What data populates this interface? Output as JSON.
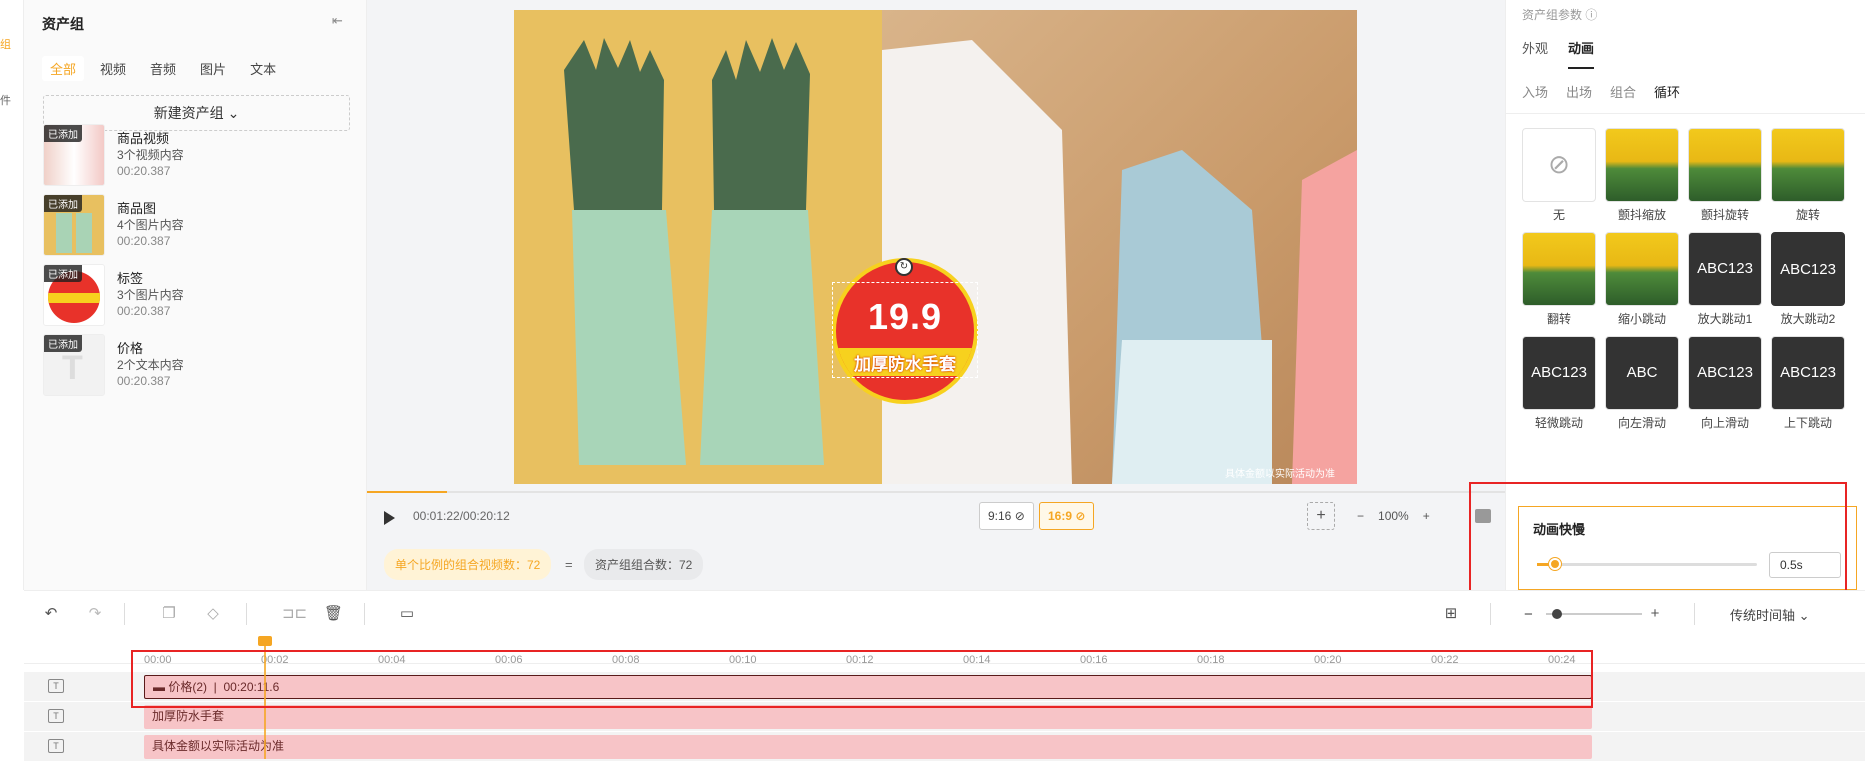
{
  "left_strip": {
    "mark1": "组",
    "mark2": "件"
  },
  "assets": {
    "title": "资产组",
    "collapse_icon": "collapse-icon",
    "tabs": [
      "全部",
      "视频",
      "音频",
      "图片",
      "文本"
    ],
    "new_group": "新建资产组",
    "items": [
      {
        "badge": "已添加",
        "name": "商品视频",
        "count": "3个视频内容",
        "duration": "00:20.387"
      },
      {
        "badge": "已添加",
        "name": "商品图",
        "count": "4个图片内容",
        "duration": "00:20.387"
      },
      {
        "badge": "已添加",
        "name": "标签",
        "count": "3个图片内容",
        "duration": "00:20.387"
      },
      {
        "badge": "已添加",
        "name": "价格",
        "count": "2个文本内容",
        "duration": "00:20.387"
      }
    ]
  },
  "preview": {
    "price": "19.9",
    "tag_label": "加厚防水手套",
    "disclaimer": "具体金额以实际活动为准",
    "timecode": "00:01:22/00:20:12",
    "ratio_916": "9:16",
    "ratio_169": "16:9",
    "add": "+",
    "zoom_minus": "−",
    "zoom": "100%",
    "zoom_plus": "+",
    "playback_progress": 0.07,
    "stat1": "单个比例的组合视频数：72",
    "equals": "=",
    "stat2": "资产组组合数：72"
  },
  "props": {
    "title": "资产组参数",
    "tabs": [
      "外观",
      "动画"
    ],
    "subtabs": [
      "入场",
      "出场",
      "组合",
      "循环"
    ],
    "animations": [
      {
        "name": "无",
        "style": "none"
      },
      {
        "name": "颤抖缩放",
        "style": "field"
      },
      {
        "name": "颤抖旋转",
        "style": "field"
      },
      {
        "name": "旋转",
        "style": "field"
      },
      {
        "name": "翻转",
        "style": "field"
      },
      {
        "name": "缩小跳动",
        "style": "field"
      },
      {
        "name": "放大跳动1",
        "style": "dark",
        "text": "ABC123"
      },
      {
        "name": "放大跳动2",
        "style": "dark",
        "text": "ABC123"
      },
      {
        "name": "轻微跳动",
        "style": "dark",
        "text": "ABC123"
      },
      {
        "name": "向左滑动",
        "style": "dark",
        "text": "ABC"
      },
      {
        "name": "向上滑动",
        "style": "dark",
        "text": "ABC123"
      },
      {
        "name": "上下跳动",
        "style": "dark",
        "text": "ABC123"
      }
    ],
    "speed_title": "动画快慢",
    "speed_value": "0.5s",
    "speed_level": 0.08
  },
  "toolbar": {
    "mode": "传统时间轴"
  },
  "timeline": {
    "ticks": [
      "00:00",
      "00:02",
      "00:04",
      "00:06",
      "00:08",
      "00:10",
      "00:12",
      "00:14",
      "00:16",
      "00:18",
      "00:20",
      "00:22",
      "00:24"
    ],
    "tracks": [
      {
        "label": "价格(2)",
        "duration": "00:20:11.6"
      },
      {
        "label": "加厚防水手套"
      },
      {
        "label": "具体金额以实际活动为准"
      }
    ]
  },
  "colors": {
    "accent": "#f5a623",
    "highlight_box": "#e82424",
    "clip": "#f7c4c7"
  }
}
